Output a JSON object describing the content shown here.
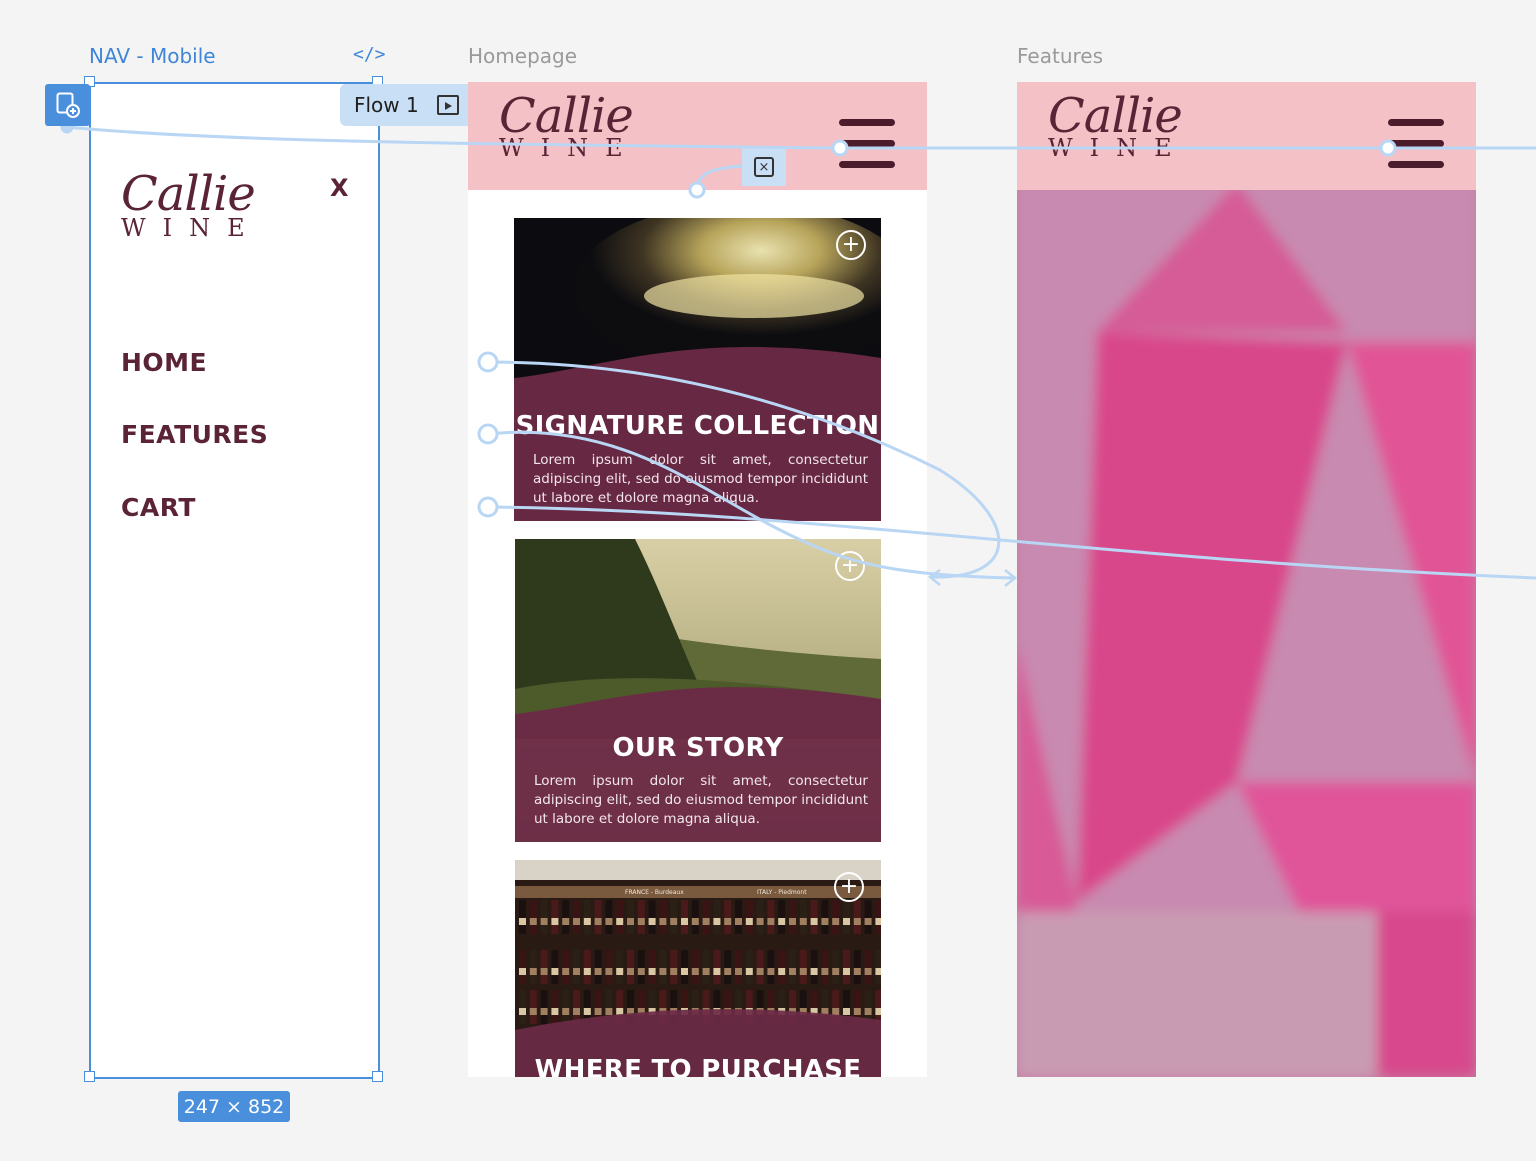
{
  "frames": {
    "nav": {
      "label": "NAV - Mobile",
      "dimensions": "247 × 852"
    },
    "homepage": {
      "label": "Homepage"
    },
    "features": {
      "label": "Features"
    }
  },
  "flow": {
    "label": "Flow 1"
  },
  "brand": {
    "script": "Callie",
    "caps": "WINE"
  },
  "nav_menu": {
    "close": "X",
    "items": [
      {
        "label": "HOME"
      },
      {
        "label": "FEATURES"
      },
      {
        "label": "CART"
      }
    ]
  },
  "cards": [
    {
      "title": "SIGNATURE COLLECTION",
      "body": "Lorem ipsum dolor sit amet, consectetur adipiscing elit, sed do eiusmod tempor incididunt ut labore et dolore magna aliqua."
    },
    {
      "title": "OUR STORY",
      "body": "Lorem ipsum dolor sit amet, consectetur adipiscing elit, sed do eiusmod tempor incididunt ut labore et dolore magna aliqua."
    },
    {
      "title": "WHERE TO PURCHASE",
      "shelf_labels": [
        "FRANCE - Burdeaux",
        "ITALY - Piedmont"
      ]
    }
  ],
  "colors": {
    "accent": "#4a8fdc",
    "header_pink": "#f4c1c6",
    "wine": "#5b2336",
    "card_overlay": "#6b2a46",
    "features_pink": "#d8408a"
  },
  "icons": {
    "code": "code-icon",
    "prototype": "prototype-play-icon",
    "add_interaction": "add-interaction-icon",
    "close_overlay": "close-overlay-icon",
    "plus": "plus-circle-icon",
    "menu": "hamburger-icon"
  }
}
